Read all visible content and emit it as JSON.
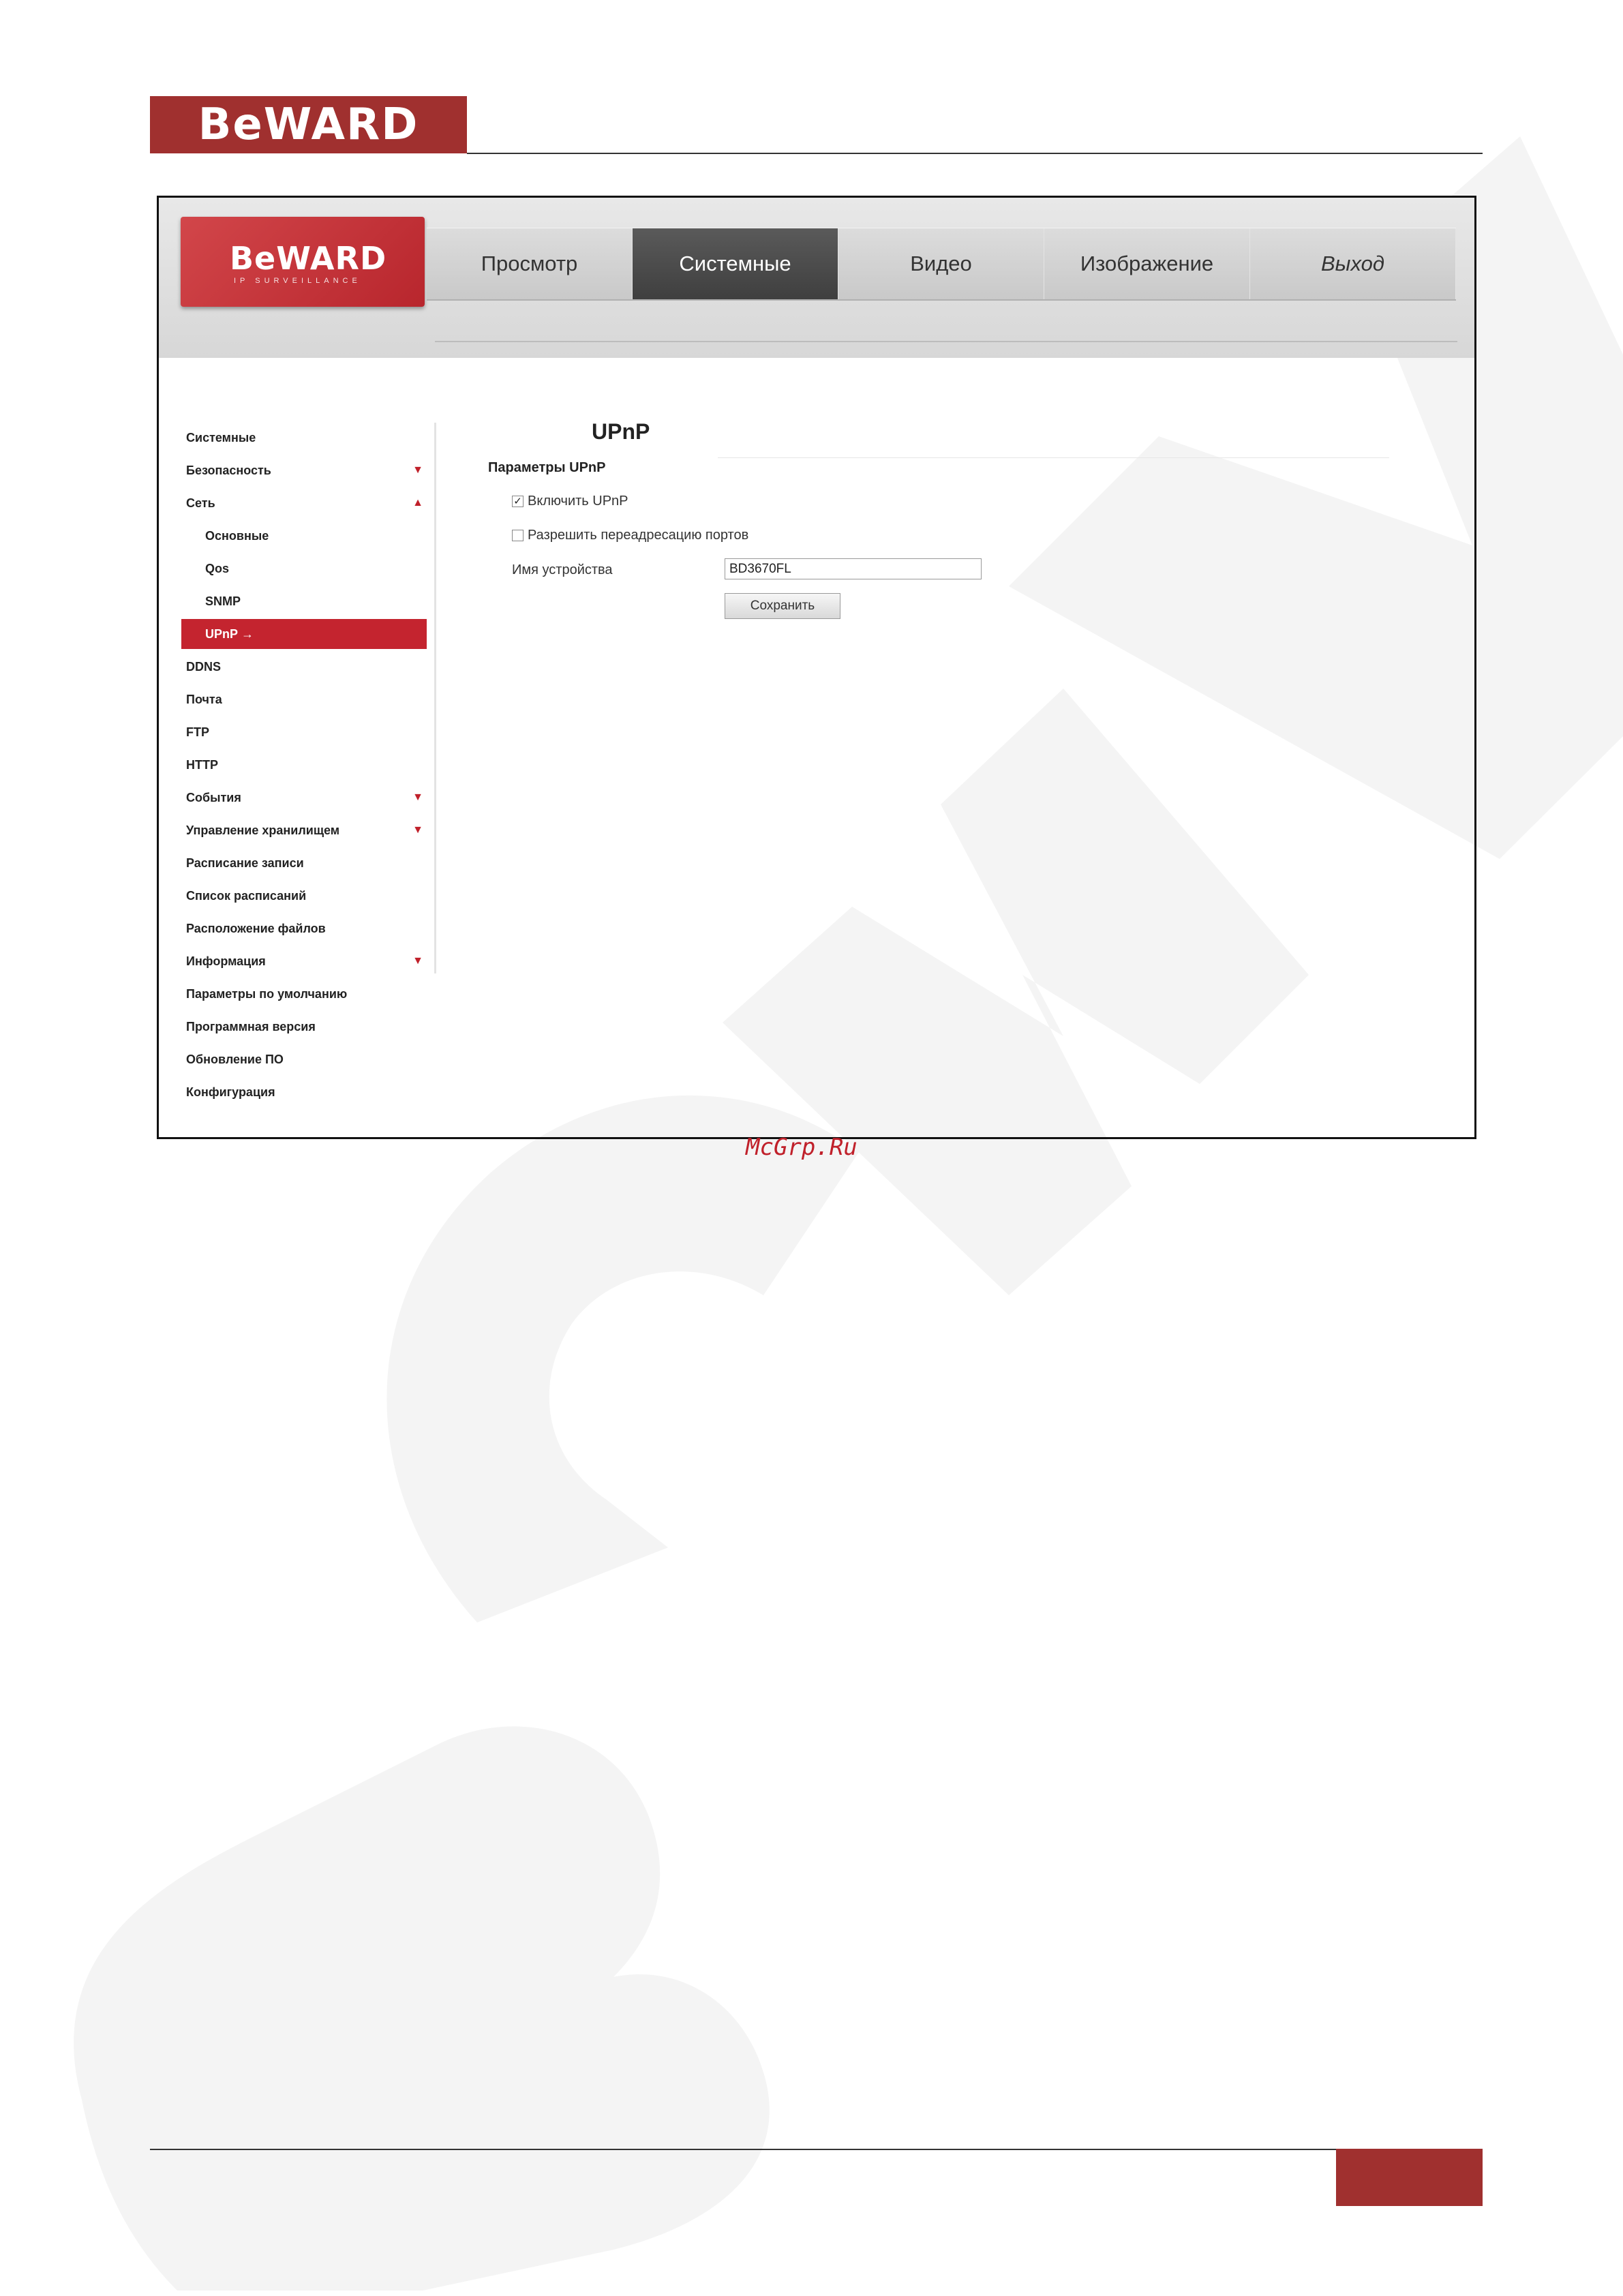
{
  "brand": {
    "logo_text": "BeWARD"
  },
  "app": {
    "logo_text": "BeWARD",
    "logo_subtitle": "IP SURVEILLANCE",
    "nav": [
      "Просмотр",
      "Системные",
      "Видео",
      "Изображение",
      "Выход"
    ],
    "active_tab": "Системные"
  },
  "sidebar": [
    {
      "label": "Системные",
      "level": 0,
      "arrow": ""
    },
    {
      "label": "Безопасность",
      "level": 0,
      "arrow": "▼"
    },
    {
      "label": "Сеть",
      "level": 0,
      "arrow": "▲"
    },
    {
      "label": "Основные",
      "level": 1,
      "arrow": ""
    },
    {
      "label": "Qos",
      "level": 1,
      "arrow": ""
    },
    {
      "label": "SNMP",
      "level": 1,
      "arrow": ""
    },
    {
      "label": "UPnP",
      "level": 1,
      "arrow": "",
      "selected": true
    },
    {
      "label": "DDNS",
      "level": 0,
      "arrow": ""
    },
    {
      "label": "Почта",
      "level": 0,
      "arrow": ""
    },
    {
      "label": "FTP",
      "level": 0,
      "arrow": ""
    },
    {
      "label": "HTTP",
      "level": 0,
      "arrow": ""
    },
    {
      "label": "События",
      "level": 0,
      "arrow": "▼"
    },
    {
      "label": "Управление хранилищем",
      "level": 0,
      "arrow": "▼"
    },
    {
      "label": "Расписание записи",
      "level": 0,
      "arrow": ""
    },
    {
      "label": "Список расписаний",
      "level": 0,
      "arrow": ""
    },
    {
      "label": "Расположение файлов",
      "level": 0,
      "arrow": ""
    },
    {
      "label": "Информация",
      "level": 0,
      "arrow": "▼"
    },
    {
      "label": "Параметры по умолчанию",
      "level": 0,
      "arrow": ""
    },
    {
      "label": "Программная версия",
      "level": 0,
      "arrow": ""
    },
    {
      "label": "Обновление ПО",
      "level": 0,
      "arrow": ""
    },
    {
      "label": "Конфигурация",
      "level": 0,
      "arrow": ""
    }
  ],
  "selected_arrow": "→",
  "content": {
    "title": "UPnP",
    "section": "Параметры UPnP",
    "enable_upnp": {
      "label": "Включить UPnP",
      "checked": true
    },
    "port_forwarding": {
      "label": "Разрешить переадресацию портов",
      "checked": false
    },
    "device_name_label": "Имя устройства",
    "device_name_value": "BD3670FL",
    "save_label": "Сохранить"
  },
  "source_text": "McGrp.Ru",
  "colors": {
    "brand": "#a0302f",
    "selected": "#c4242f",
    "arrow": "#c0202a",
    "watermark": "#f4f4f4"
  }
}
